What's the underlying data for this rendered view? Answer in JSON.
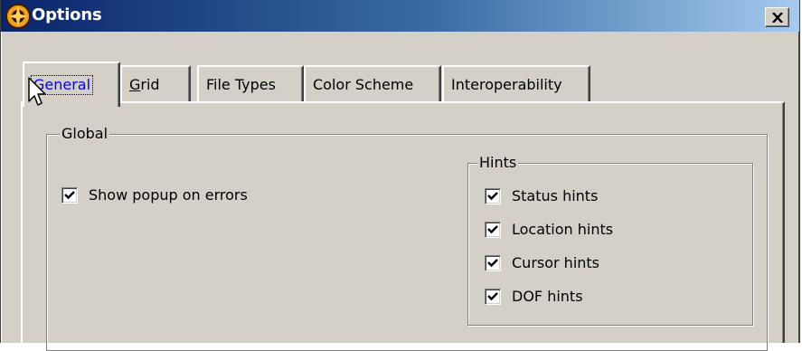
{
  "window": {
    "title": "Options",
    "close_label": "×"
  },
  "tabs": [
    {
      "label": "General",
      "active": true
    },
    {
      "label": "Grid",
      "mnemonic": "G",
      "rest": "rid"
    },
    {
      "label": "File Types"
    },
    {
      "label": "Color Scheme"
    },
    {
      "label": "Interoperability"
    }
  ],
  "global_group": {
    "title": "Global",
    "show_popup": {
      "label": "Show popup on errors",
      "checked": true
    }
  },
  "hints_group": {
    "title": "Hints",
    "items": [
      {
        "label": "Status hints",
        "checked": true
      },
      {
        "label": "Location hints",
        "checked": true
      },
      {
        "label": "Cursor hints",
        "checked": true
      },
      {
        "label": "DOF hints",
        "checked": true
      }
    ]
  },
  "icons": {
    "app": "app-logo-icon",
    "close": "close-icon",
    "check": "checkmark-icon",
    "cursor": "mouse-pointer-icon"
  }
}
